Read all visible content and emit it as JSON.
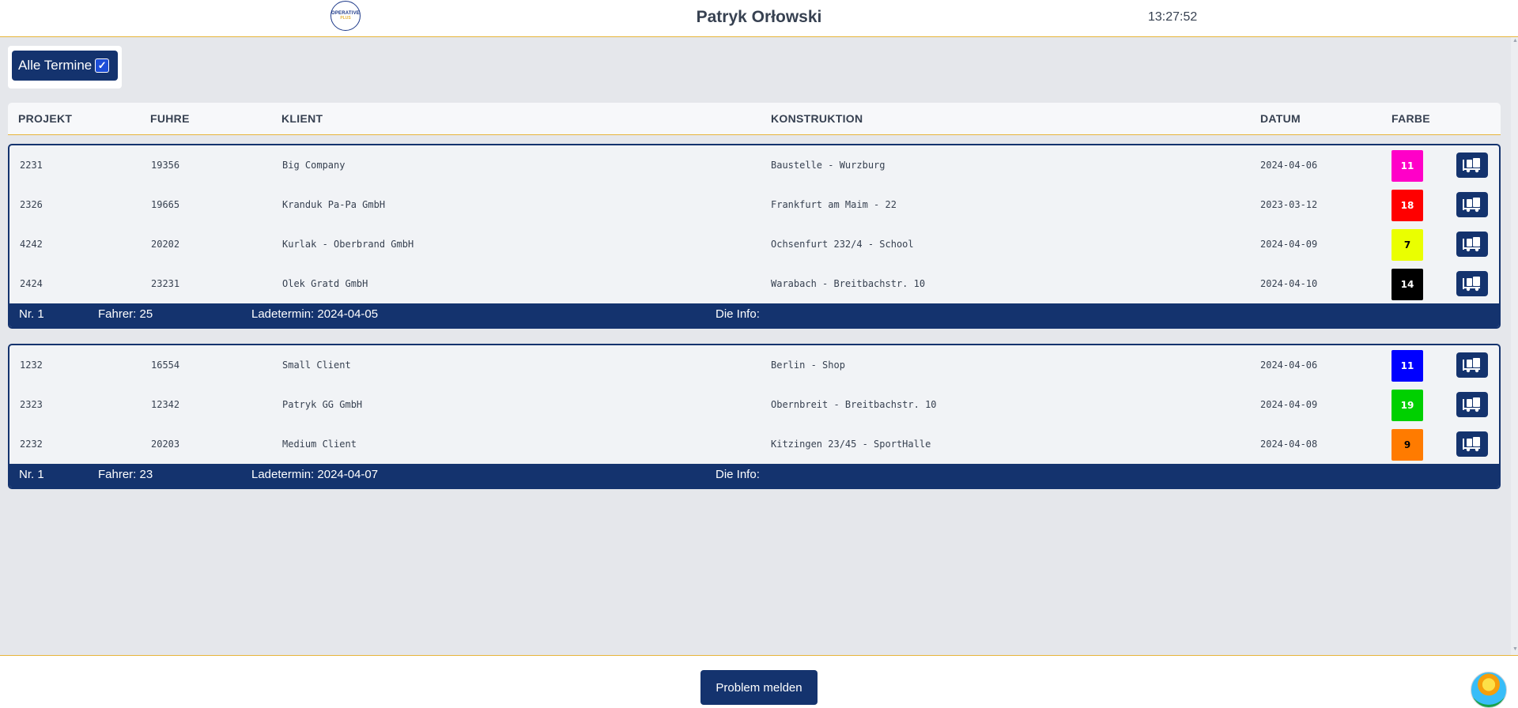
{
  "header": {
    "logo_text": "OPERATIVE",
    "logo_sub": "PLUS",
    "user_name": "Patryk Orłowski",
    "clock": "13:27:52"
  },
  "toggle": {
    "label": "Alle Termine",
    "checked": true
  },
  "table": {
    "headers": [
      "PROJEKT",
      "FUHRE",
      "KLIENT",
      "KONSTRUKTION",
      "DATUM",
      "FARBE"
    ]
  },
  "groups": [
    {
      "rows": [
        {
          "projekt": "2231",
          "fuhre": "19356",
          "klient": "Big Company",
          "konstruktion": "Baustelle - Wurzburg",
          "datum": "2024-04-06",
          "farbe": "11",
          "color": "#ff00c8",
          "text_color": "#ffffff"
        },
        {
          "projekt": "2326",
          "fuhre": "19665",
          "klient": "Kranduk Pa-Pa GmbH",
          "konstruktion": "Frankfurt am Maim - 22",
          "datum": "2023-03-12",
          "farbe": "18",
          "color": "#ff0000",
          "text_color": "#ffffff"
        },
        {
          "projekt": "4242",
          "fuhre": "20202",
          "klient": "Kurlak - Oberbrand GmbH",
          "konstruktion": "Ochsenfurt 232/4 - School",
          "datum": "2024-04-09",
          "farbe": "7",
          "color": "#eaff00",
          "text_color": "#000000"
        },
        {
          "projekt": "2424",
          "fuhre": "23231",
          "klient": "Olek Gratd GmbH",
          "konstruktion": "Warabach - Breitbachstr. 10",
          "datum": "2024-04-10",
          "farbe": "14",
          "color": "#000000",
          "text_color": "#ffffff"
        }
      ],
      "footer": {
        "nr": "Nr. 1",
        "fahrer": "Fahrer: 25",
        "ladetermin": "Ladetermin: 2024-04-05",
        "info": "Die Info:"
      }
    },
    {
      "rows": [
        {
          "projekt": "1232",
          "fuhre": "16554",
          "klient": "Small Client",
          "konstruktion": "Berlin - Shop",
          "datum": "2024-04-06",
          "farbe": "11",
          "color": "#0000ff",
          "text_color": "#ffffff"
        },
        {
          "projekt": "2323",
          "fuhre": "12342",
          "klient": "Patryk GG GmbH",
          "konstruktion": "Obernbreit - Breitbachstr. 10",
          "datum": "2024-04-09",
          "farbe": "19",
          "color": "#00d000",
          "text_color": "#ffffff"
        },
        {
          "projekt": "2232",
          "fuhre": "20203",
          "klient": "Medium Client",
          "konstruktion": "Kitzingen 23/45 - SportHalle",
          "datum": "2024-04-08",
          "farbe": "9",
          "color": "#ff7b00",
          "text_color": "#000000"
        }
      ],
      "footer": {
        "nr": "Nr. 1",
        "fahrer": "Fahrer: 23",
        "ladetermin": "Ladetermin: 2024-04-07",
        "info": "Die Info:"
      }
    }
  ],
  "bottom": {
    "problem_button": "Problem melden"
  },
  "icons": {
    "row_action": "truck-icon",
    "avatar": "avatar-image",
    "logo": "logo-image"
  },
  "colors": {
    "primary": "#14336e",
    "accent": "#e7b53b",
    "background": "#e5e7eb"
  }
}
